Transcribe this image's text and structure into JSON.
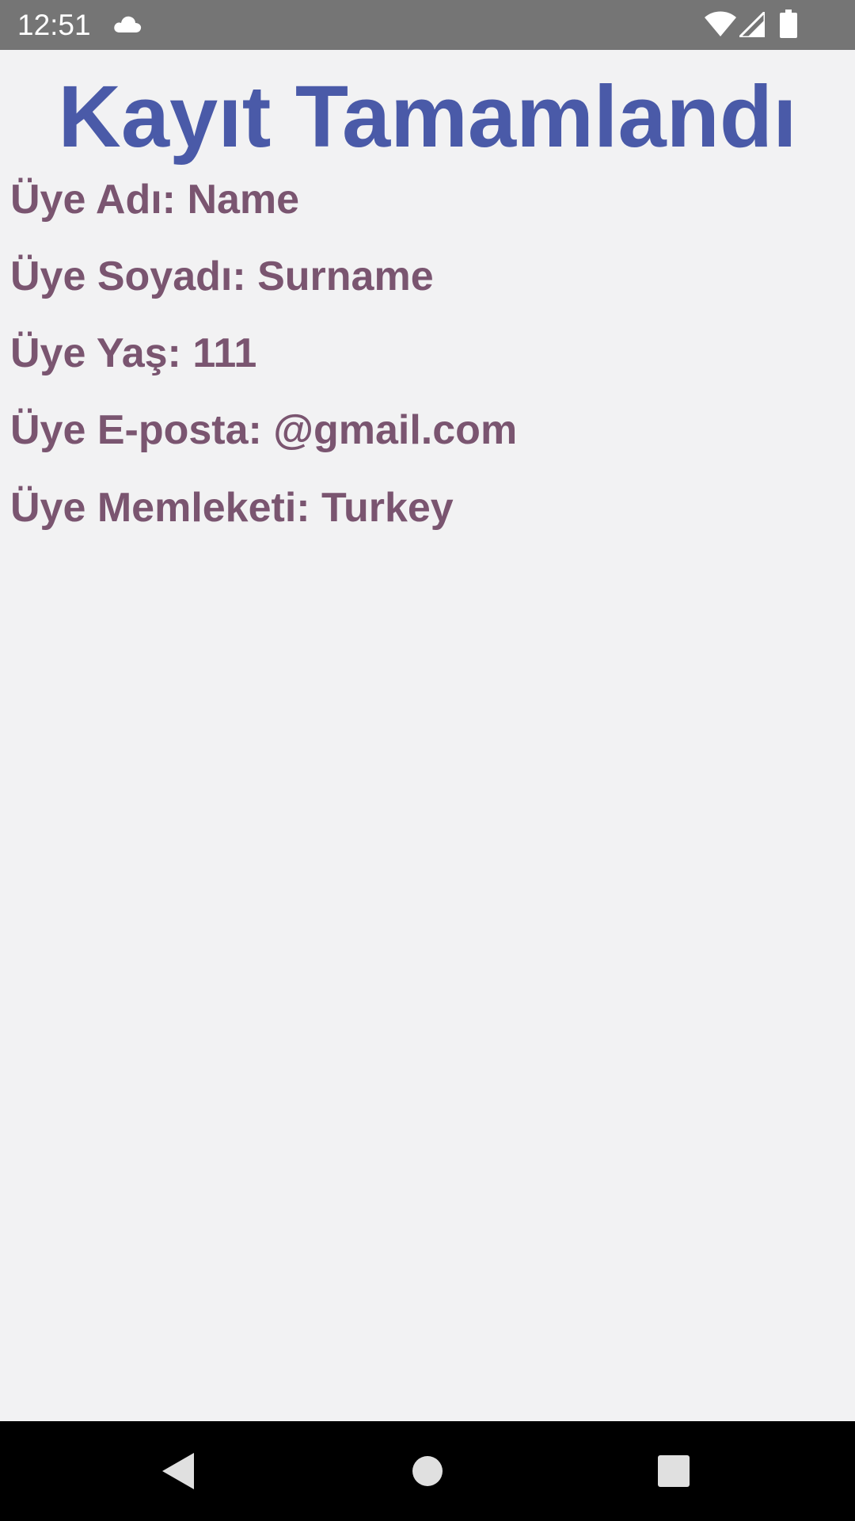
{
  "status_bar": {
    "time": "12:51",
    "icons": [
      "cloud-icon",
      "wifi-icon",
      "signal-icon",
      "battery-icon"
    ]
  },
  "screen": {
    "title": "Kayıt Tamamlandı",
    "rows": [
      "Üye Adı: Name",
      "Üye Soyadı: Surname",
      "Üye Yaş: 111",
      "Üye E-posta: @gmail.com",
      "Üye Memleketi: Turkey"
    ]
  },
  "nav_bar": {
    "buttons": [
      "back-icon",
      "home-icon",
      "recents-icon"
    ]
  },
  "colors": {
    "title": "#4a5aa8",
    "row_text": "#7a5570",
    "background": "#f2f2f3",
    "status_bar": "#757575",
    "nav_bar": "#000000"
  }
}
